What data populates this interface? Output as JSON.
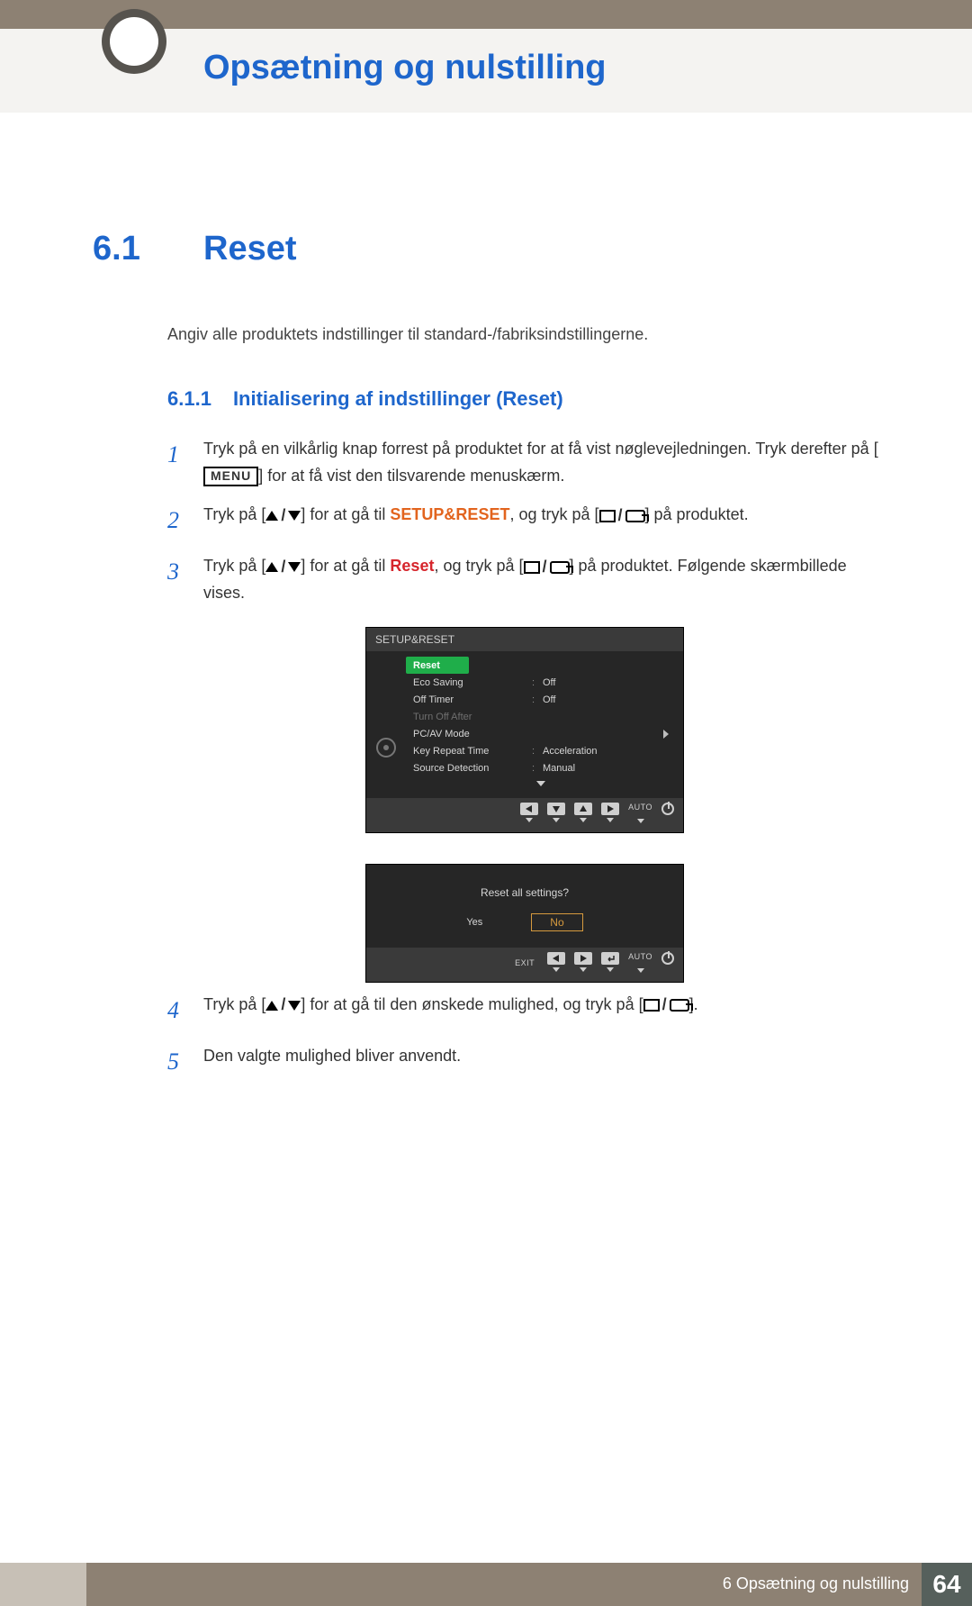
{
  "header": {
    "chapter_title": "Opsætning og nulstilling"
  },
  "section": {
    "num": "6.1",
    "title": "Reset"
  },
  "intro": "Angiv alle produktets indstillinger til standard-/fabriksindstillingerne.",
  "subsection": {
    "num": "6.1.1",
    "title": "Initialisering af indstillinger (Reset)"
  },
  "steps": {
    "s1a": "Tryk på en vilkårlig knap forrest på produktet for at få vist nøglevejledningen. Tryk derefter på [",
    "s1_menu": "MENU",
    "s1b": "] for at få vist den tilsvarende menuskærm.",
    "s2a": "Tryk på [",
    "s2b": "] for at gå til ",
    "s2_target": "SETUP&RESET",
    "s2c": ", og tryk på [",
    "s2d": "] på produktet.",
    "s3a": "Tryk på [",
    "s3b": "] for at gå til ",
    "s3_target": "Reset",
    "s3c": ", og tryk på [",
    "s3d": "] på produktet. Følgende skærmbillede vises.",
    "s4a": "Tryk på [",
    "s4b": "] for at gå til den ønskede mulighed, og tryk på [",
    "s4c": "].",
    "s5": "Den valgte mulighed bliver anvendt.",
    "n1": "1",
    "n2": "2",
    "n3": "3",
    "n4": "4",
    "n5": "5"
  },
  "osd1": {
    "title": "SETUP&RESET",
    "rows": [
      {
        "label": "Reset",
        "selected": true
      },
      {
        "label": "Eco Saving",
        "colon": ":",
        "value": "Off"
      },
      {
        "label": "Off Timer",
        "colon": ":",
        "value": "Off"
      },
      {
        "label": "Turn Off After",
        "dim": true
      },
      {
        "label": "PC/AV Mode",
        "caret": true
      },
      {
        "label": "Key Repeat Time",
        "colon": ":",
        "value": "Acceleration"
      },
      {
        "label": "Source Detection",
        "colon": ":",
        "value": "Manual"
      }
    ],
    "foot_auto": "AUTO"
  },
  "osd2": {
    "question": "Reset all settings?",
    "yes": "Yes",
    "no": "No",
    "exit": "EXIT",
    "auto": "AUTO"
  },
  "footer": {
    "text": "6 Opsætning og nulstilling",
    "page": "64"
  }
}
